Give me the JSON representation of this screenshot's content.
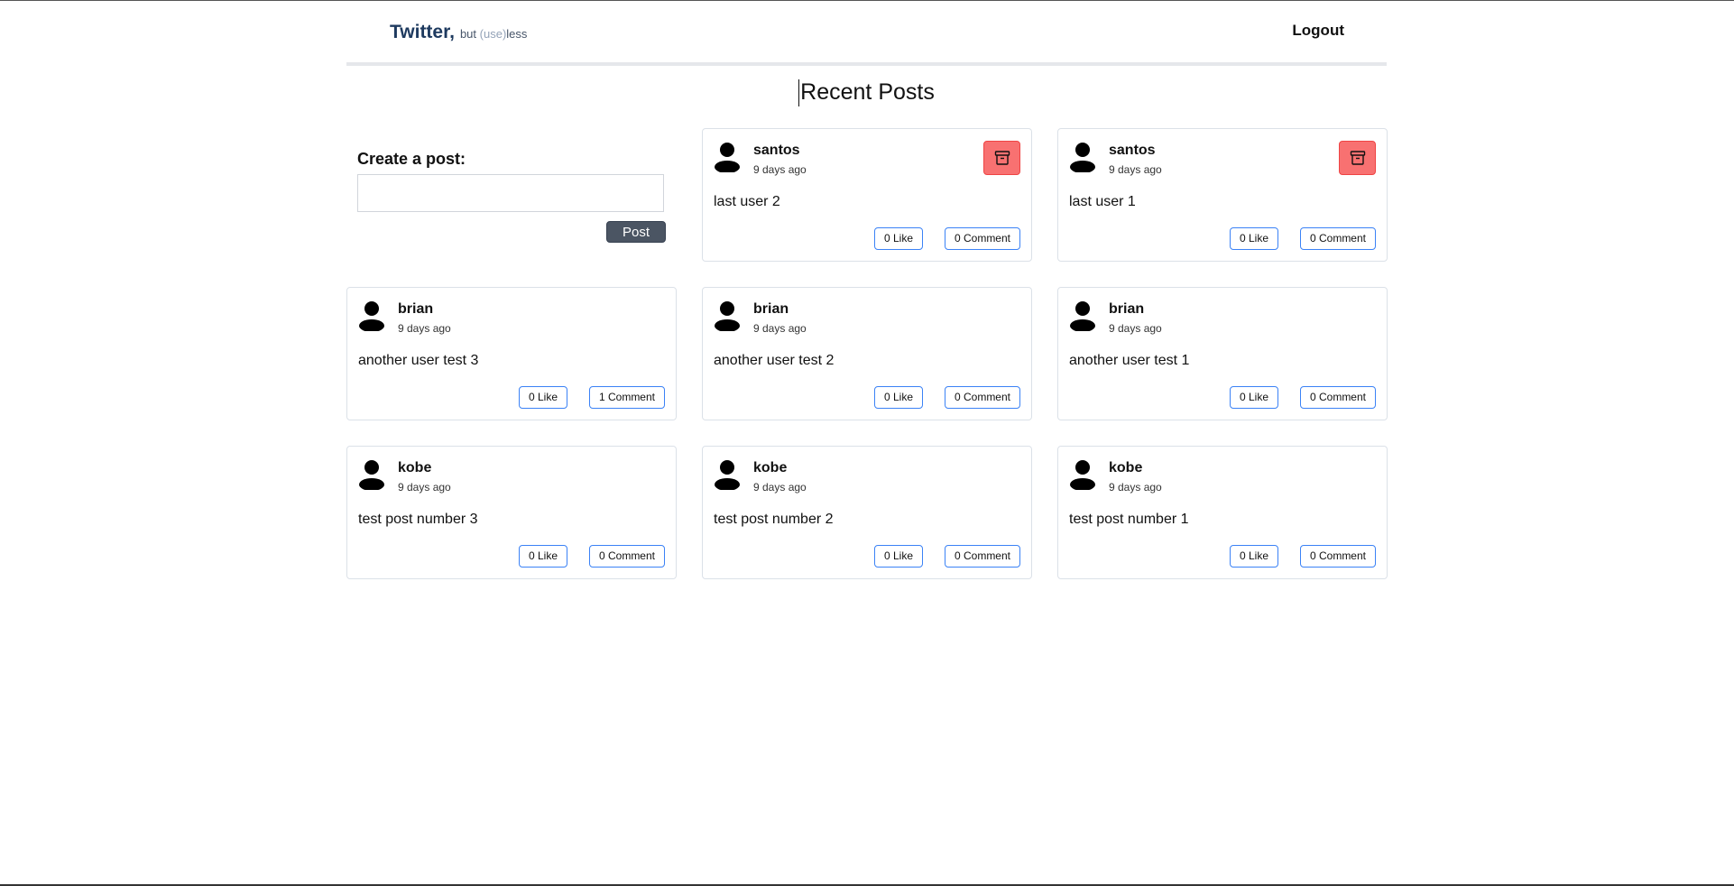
{
  "nav": {
    "brand_title": "Twitter,",
    "brand_but": "but",
    "brand_use": "(use)",
    "brand_less": "less",
    "logout_label": "Logout"
  },
  "page": {
    "title": "Recent Posts"
  },
  "create": {
    "label": "Create a post:",
    "input_value": "",
    "button_label": "Post"
  },
  "posts": [
    {
      "user": "santos",
      "time": "9 days ago",
      "content": "last user 2",
      "like_label": "0 Like",
      "comment_label": "0 Comment",
      "deletable": true
    },
    {
      "user": "santos",
      "time": "9 days ago",
      "content": "last user 1",
      "like_label": "0 Like",
      "comment_label": "0 Comment",
      "deletable": true
    },
    {
      "user": "brian",
      "time": "9 days ago",
      "content": "another user test 3",
      "like_label": "0 Like",
      "comment_label": "1 Comment",
      "deletable": false
    },
    {
      "user": "brian",
      "time": "9 days ago",
      "content": "another user test 2",
      "like_label": "0 Like",
      "comment_label": "0 Comment",
      "deletable": false
    },
    {
      "user": "brian",
      "time": "9 days ago",
      "content": "another user test 1",
      "like_label": "0 Like",
      "comment_label": "0 Comment",
      "deletable": false
    },
    {
      "user": "kobe",
      "time": "9 days ago",
      "content": "test post number 3",
      "like_label": "0 Like",
      "comment_label": "0 Comment",
      "deletable": false
    },
    {
      "user": "kobe",
      "time": "9 days ago",
      "content": "test post number 2",
      "like_label": "0 Like",
      "comment_label": "0 Comment",
      "deletable": false
    },
    {
      "user": "kobe",
      "time": "9 days ago",
      "content": "test post number 1",
      "like_label": "0 Like",
      "comment_label": "0 Comment",
      "deletable": false
    }
  ],
  "icons": {
    "avatar": "user-avatar-icon",
    "delete": "archive-icon"
  },
  "colors": {
    "brand": "#1e3a5f",
    "post_button": "#4b5563",
    "delete_button": "#f87171",
    "action_border": "#3b82f6"
  }
}
